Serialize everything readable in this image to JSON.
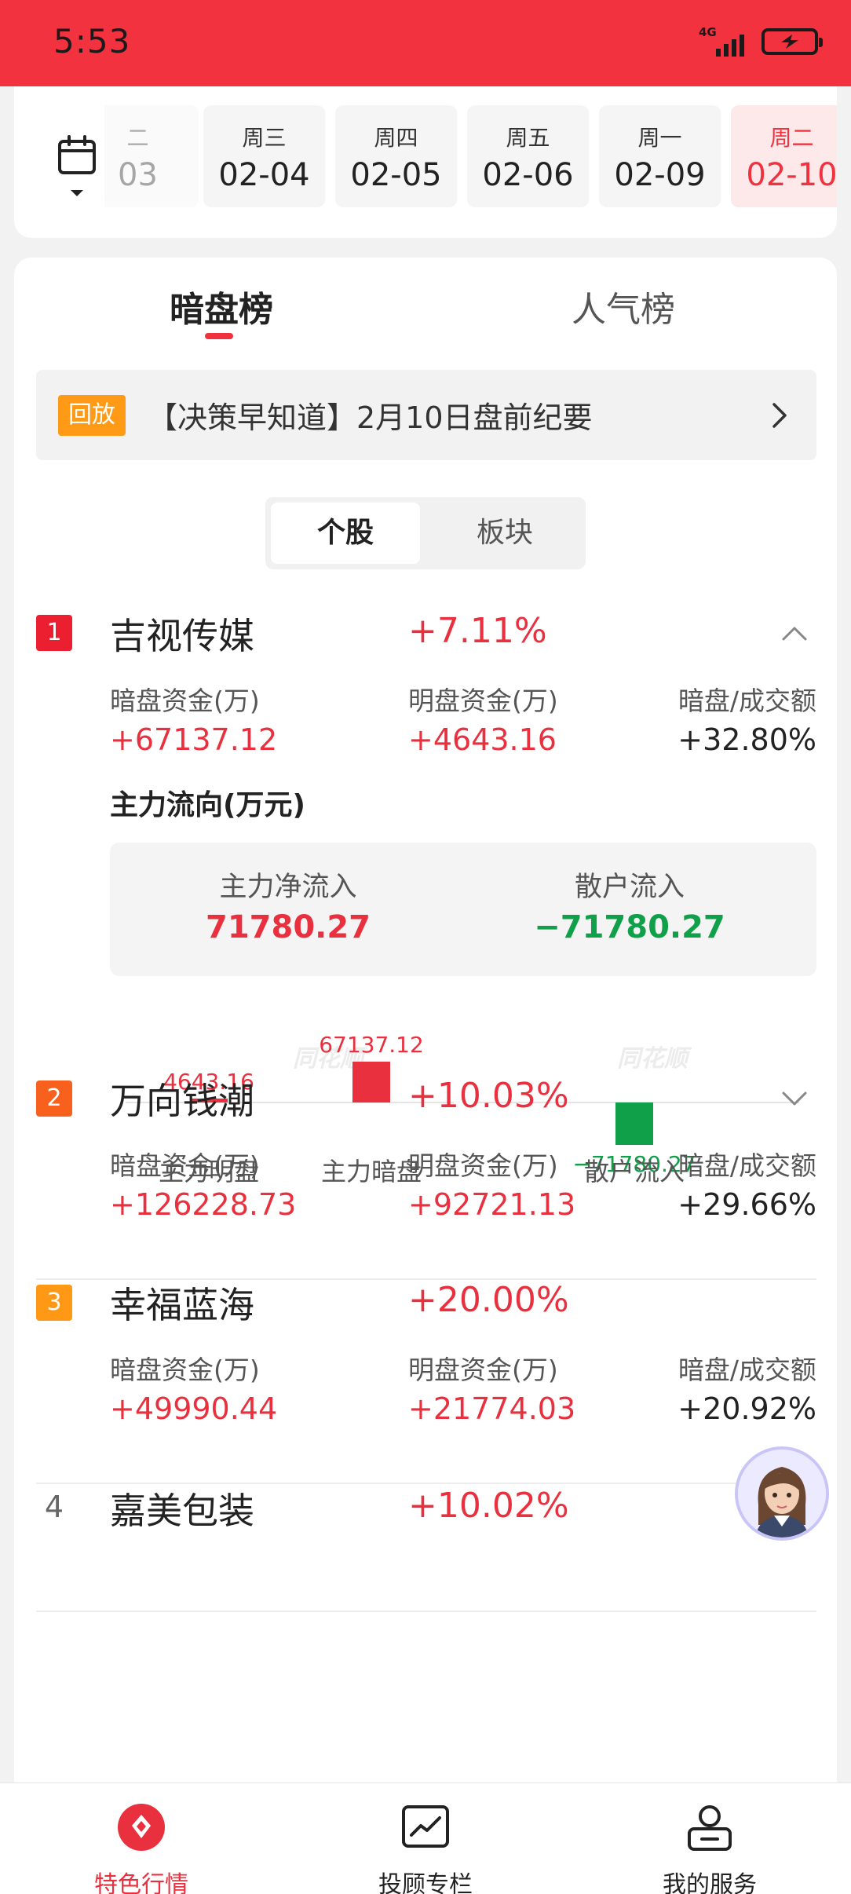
{
  "status_bar": {
    "time": "5:53",
    "network": "4G"
  },
  "dates": [
    {
      "weekday": "二",
      "date": "03",
      "state": "faded"
    },
    {
      "weekday": "周三",
      "date": "02-04",
      "state": "normal"
    },
    {
      "weekday": "周四",
      "date": "02-05",
      "state": "normal"
    },
    {
      "weekday": "周五",
      "date": "02-06",
      "state": "normal"
    },
    {
      "weekday": "周一",
      "date": "02-09",
      "state": "normal"
    },
    {
      "weekday": "周二",
      "date": "02-10",
      "state": "active"
    }
  ],
  "tabs": {
    "active": "暗盘榜",
    "inactive": "人气榜"
  },
  "notice": {
    "tag": "回放",
    "text": "【决策早知道】2月10日盘前纪要"
  },
  "segment": {
    "active": "个股",
    "inactive": "板块"
  },
  "column_labels": {
    "dark": "暗盘资金(万)",
    "bright": "明盘资金(万)",
    "ratio": "暗盘/成交额"
  },
  "stocks": [
    {
      "rank": "1",
      "name": "吉视传媒",
      "change": "+7.11%",
      "dark_funds": "+67137.12",
      "bright_funds": "+4643.16",
      "ratio": "+32.80%",
      "expanded": true
    },
    {
      "rank": "2",
      "name": "万向钱潮",
      "change": "+10.03%",
      "dark_funds": "+126228.73",
      "bright_funds": "+92721.13",
      "ratio": "+29.66%",
      "expanded": false
    },
    {
      "rank": "3",
      "name": "幸福蓝海",
      "change": "+20.00%",
      "dark_funds": "+49990.44",
      "bright_funds": "+21774.03",
      "ratio": "+20.92%",
      "expanded": false
    },
    {
      "rank": "4",
      "name": "嘉美包装",
      "change": "+10.02%",
      "expanded": false
    }
  ],
  "flow": {
    "title": "主力流向(万元)",
    "main_net_label": "主力净流入",
    "main_net_value": "71780.27",
    "retail_label": "散户流入",
    "retail_value": "−71780.27"
  },
  "chart_data": [
    {
      "type": "bar",
      "categories": [
        "主力明盘",
        "主力暗盘"
      ],
      "values": [
        4643.16,
        67137.12
      ],
      "value_labels": [
        "4643.16",
        "67137.12"
      ],
      "watermark": "同花顺"
    },
    {
      "type": "bar",
      "categories": [
        "散户流入"
      ],
      "values": [
        -71780.27
      ],
      "value_labels": [
        "−71780.27"
      ],
      "watermark": "同花顺"
    }
  ],
  "colors": {
    "accent": "#f2333f",
    "up": "#e8303e",
    "down": "#10a04a",
    "tag_orange": "#ff9a17"
  },
  "bottom_nav": [
    {
      "label": "特色行情",
      "icon": "market-icon",
      "active": true
    },
    {
      "label": "投顾专栏",
      "icon": "chart-trend-icon",
      "active": false
    },
    {
      "label": "我的服务",
      "icon": "service-icon",
      "active": false
    }
  ]
}
